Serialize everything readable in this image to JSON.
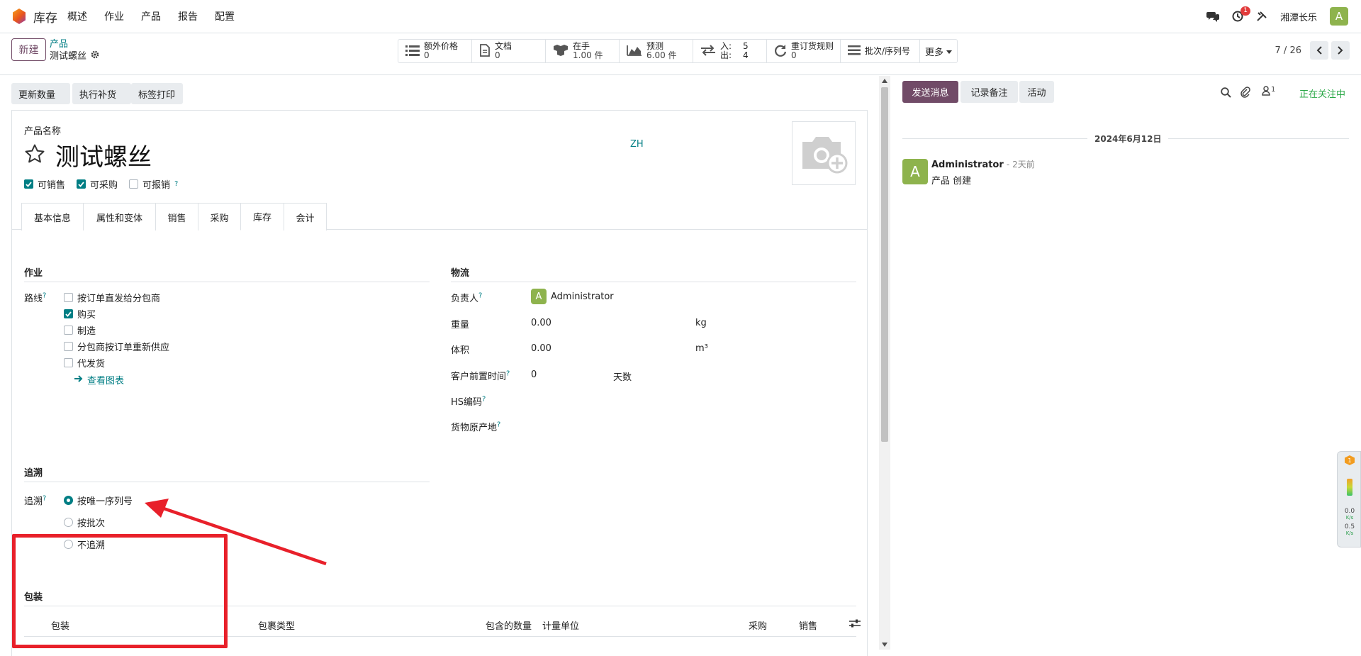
{
  "nav": {
    "brand": "库存",
    "menu": [
      "概述",
      "作业",
      "产品",
      "报告",
      "配置"
    ],
    "activity_badge": "1",
    "company": "湘潭长乐",
    "avatar_letter": "A"
  },
  "control_panel": {
    "new_label": "新建",
    "breadcrumb_parent": "产品",
    "breadcrumb_current": "测试螺丝",
    "stats": [
      {
        "label": "额外价格",
        "value": "0",
        "icon": "list-icon"
      },
      {
        "label": "文档",
        "value": "0",
        "icon": "file-icon"
      },
      {
        "label": "在手",
        "value": "1.00 件",
        "icon": "cubes-icon"
      },
      {
        "label": "预测",
        "value": "6.00 件",
        "icon": "chart-area-icon"
      },
      {
        "label": "入:",
        "value": "5",
        "label2": "出:",
        "value2": "4",
        "icon": "exchange-icon"
      },
      {
        "label": "重订货规则",
        "value": "0",
        "icon": "refresh-icon"
      },
      {
        "label": "批次/序列号",
        "value": "",
        "icon": "bars-icon"
      }
    ],
    "more_label": "更多",
    "pager": "7 / 26"
  },
  "status_buttons": [
    "更新数量",
    "执行补货",
    "标签打印"
  ],
  "product": {
    "name_label": "产品名称",
    "name": "测试螺丝",
    "lang": "ZH",
    "can_sell": "可销售",
    "can_purchase": "可采购",
    "can_expense": "可报销"
  },
  "tabs": [
    "基本信息",
    "属性和变体",
    "销售",
    "采购",
    "库存",
    "会计"
  ],
  "operations": {
    "heading": "作业",
    "routes_label": "路线",
    "routes": [
      {
        "label": "按订单直发给分包商",
        "checked": false
      },
      {
        "label": "购买",
        "checked": true
      },
      {
        "label": "制造",
        "checked": false
      },
      {
        "label": "分包商按订单重新供应",
        "checked": false
      },
      {
        "label": "代发货",
        "checked": false
      }
    ],
    "view_diagram": "查看图表"
  },
  "logistics": {
    "heading": "物流",
    "responsible_label": "负责人",
    "responsible": "Administrator",
    "weight_label": "重量",
    "weight": "0.00",
    "weight_unit": "kg",
    "volume_label": "体积",
    "volume": "0.00",
    "volume_unit": "m³",
    "lead_label": "客户前置时间",
    "lead": "0",
    "lead_unit": "天数",
    "hs_label": "HS编码",
    "origin_label": "货物原产地"
  },
  "traceability": {
    "heading": "追溯",
    "label": "追溯",
    "options": [
      "按唯一序列号",
      "按批次",
      "不追溯"
    ],
    "selected": 0
  },
  "packaging": {
    "heading": "包装",
    "columns": [
      "包装",
      "包裹类型",
      "包含的数量",
      "计量单位",
      "采购",
      "销售"
    ]
  },
  "chatter": {
    "send_message": "发送消息",
    "log_note": "记录备注",
    "activity": "活动",
    "followers_count": "1",
    "following": "正在关注中",
    "date": "2024年6月12日",
    "author": "Administrator",
    "time": "- 2天前",
    "message": "产品 创建"
  },
  "widget": {
    "badge": "1",
    "up": "0.0",
    "up_unit": "K/s",
    "down": "0.5",
    "down_unit": "K/s"
  },
  "colors": {
    "primary": "#714b67",
    "accent": "#017e84",
    "annotation": "#e8202a"
  }
}
